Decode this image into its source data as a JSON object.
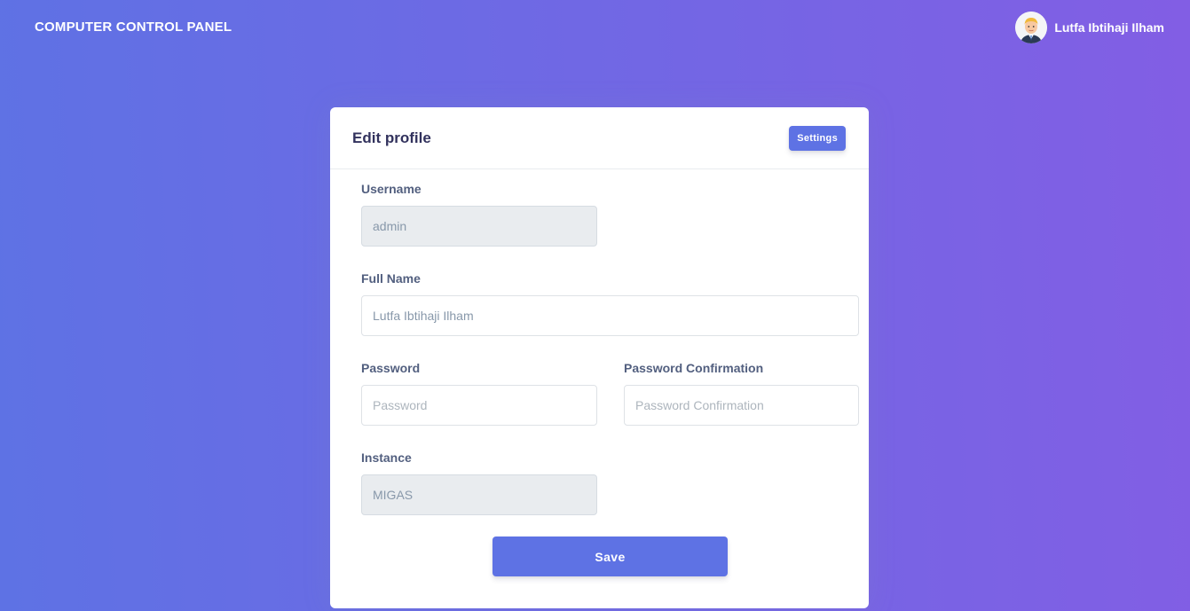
{
  "navbar": {
    "brand": "COMPUTER CONTROL PANEL",
    "user_name": "Lutfa Ibtihaji Ilham",
    "avatar_icon": "user-avatar-icon"
  },
  "card": {
    "title": "Edit profile",
    "settings_label": "Settings"
  },
  "form": {
    "username": {
      "label": "Username",
      "value": "admin",
      "disabled": true
    },
    "full_name": {
      "label": "Full Name",
      "value": "Lutfa Ibtihaji Ilham"
    },
    "password": {
      "label": "Password",
      "placeholder": "Password"
    },
    "password_confirmation": {
      "label": "Password Confirmation",
      "placeholder": "Password Confirmation"
    },
    "instance": {
      "label": "Instance",
      "value": "MIGAS",
      "disabled": true
    },
    "save_label": "Save"
  },
  "colors": {
    "primary": "#5e72e4",
    "gradient_start": "#5e72e4",
    "gradient_end": "#825ee4"
  }
}
